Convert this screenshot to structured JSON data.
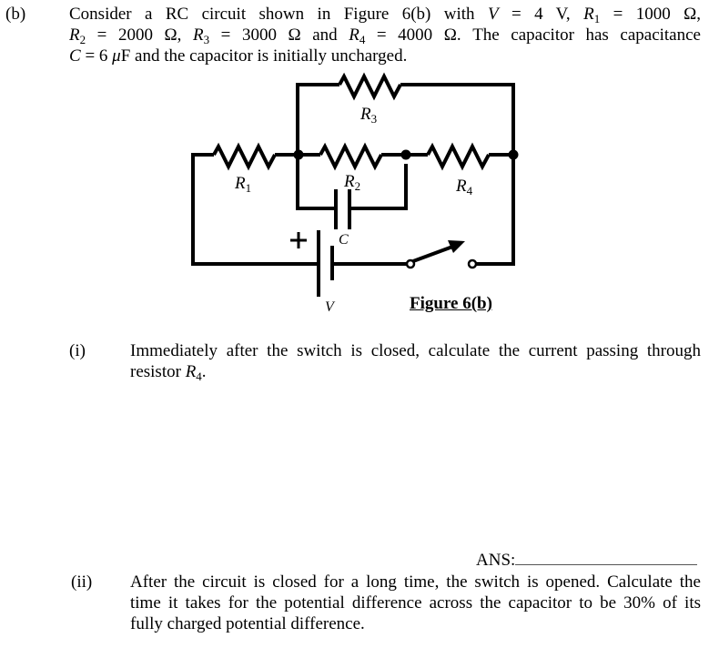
{
  "part_b": {
    "label": "(b)",
    "intro": {
      "line1": [
        "Consider a RC circuit shown in Figure 6(b) with ",
        "V",
        " = 4  V,  ",
        "R",
        "1",
        " = 1000 Ω,"
      ],
      "line2": [
        "R",
        "2",
        " = 2000 Ω,  ",
        "R",
        "3",
        " = 3000 Ω  and  ",
        "R",
        "4",
        " = 4000 Ω.  The  capacitor  has  capacitance"
      ],
      "line3": [
        "C",
        " = 6 ",
        "μ",
        "F and the capacitor is initially uncharged."
      ]
    },
    "given": {
      "V": "4 V",
      "R1": "1000 Ω",
      "R2": "2000 Ω",
      "R3": "3000 Ω",
      "R4": "4000 Ω",
      "C": "6 μF"
    }
  },
  "figure": {
    "caption": "Figure 6(b)",
    "labels": {
      "R1": "R",
      "R1_sub": "1",
      "R2": "R",
      "R2_sub": "2",
      "R3": "R",
      "R3_sub": "3",
      "R4": "R",
      "R4_sub": "4",
      "C": "C",
      "V": "V",
      "plus": "+"
    },
    "components": [
      "resistor R1",
      "resistor R2",
      "resistor R3",
      "resistor R4",
      "capacitor C",
      "battery V",
      "open switch"
    ],
    "switch_state": "open"
  },
  "question_i": {
    "label": "(i)",
    "line1": "Immediately after the switch is closed, calculate the current passing through",
    "line2_prefix": "resistor ",
    "line2_var": "R",
    "line2_sub": "4",
    "line2_suffix": "."
  },
  "answer": {
    "label": "ANS:",
    "value": ""
  },
  "question_ii": {
    "label": "(ii)",
    "line1": "After the circuit is closed for a long time, the switch is opened. Calculate the",
    "line2": "time it takes for the potential difference across the capacitor to be 30% of its",
    "line3": "fully charged potential difference."
  }
}
